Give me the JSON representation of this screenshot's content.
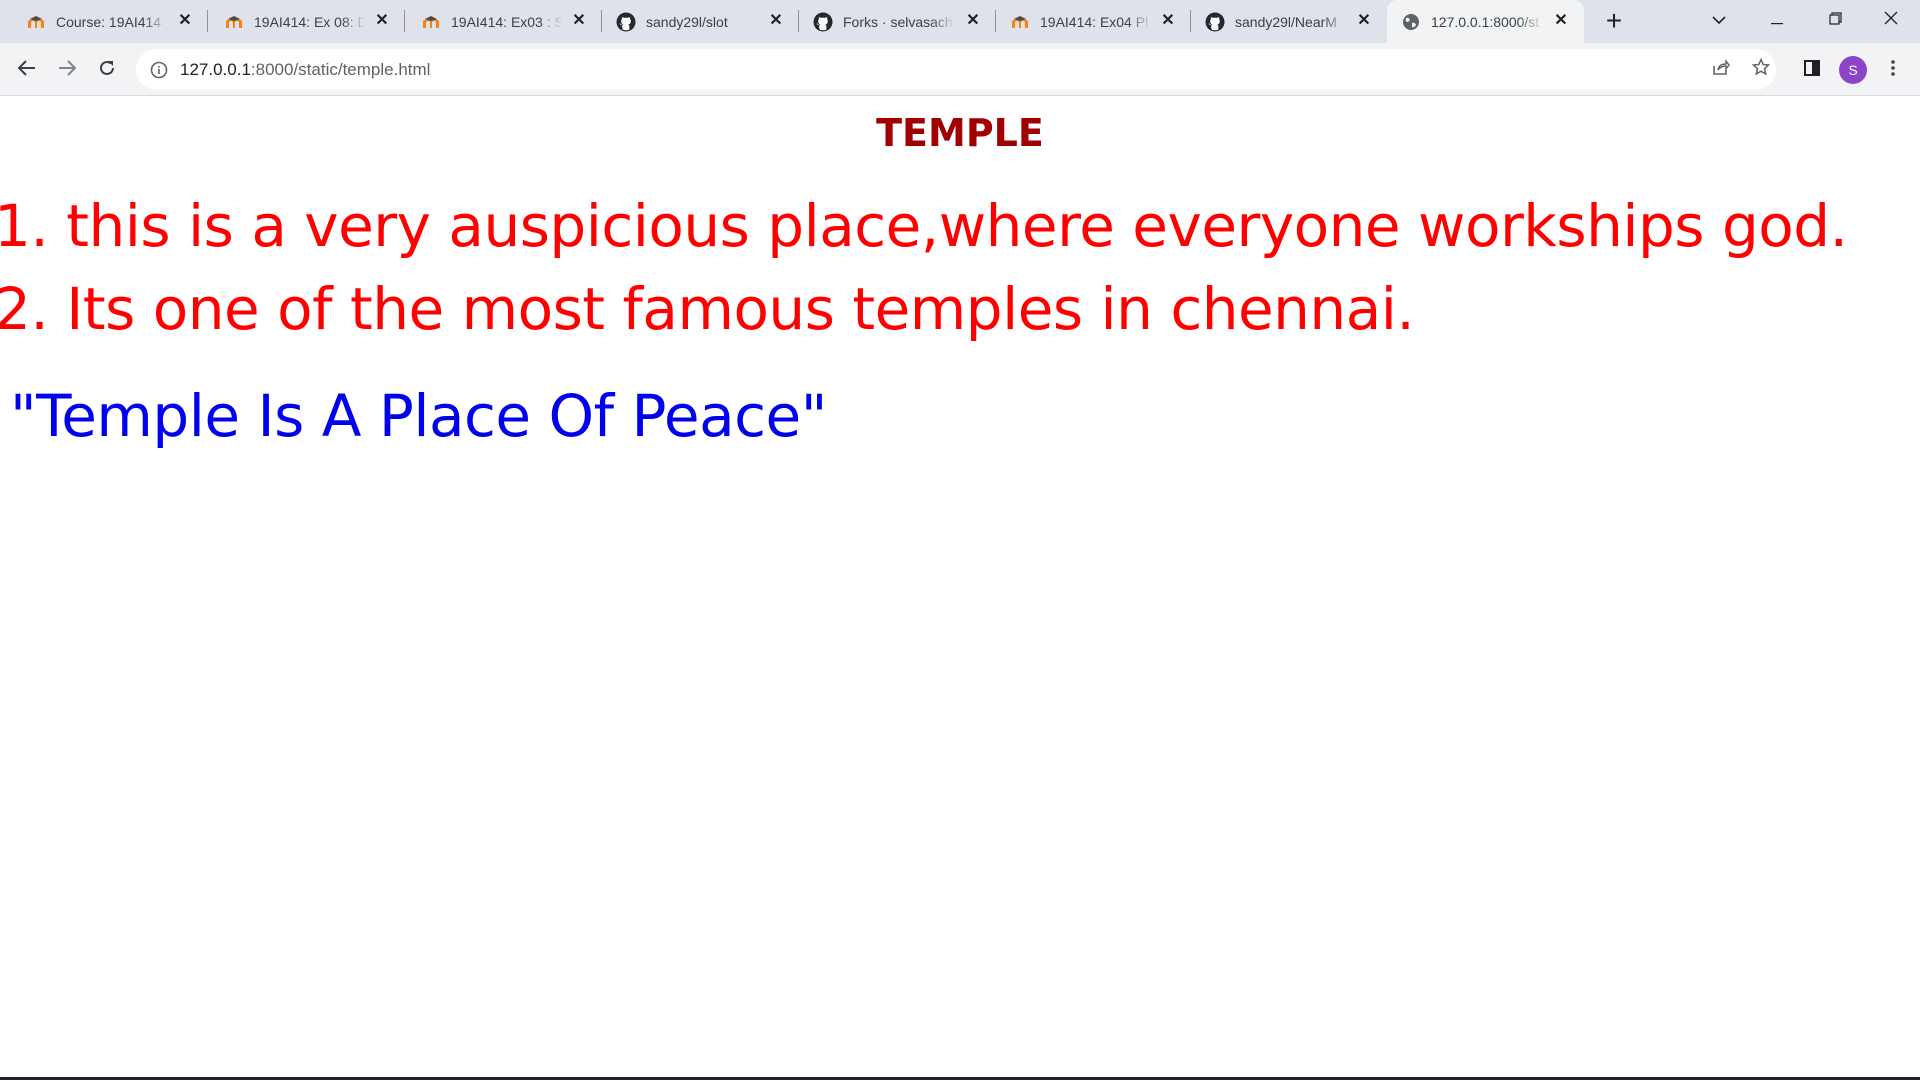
{
  "browser": {
    "tabs": [
      {
        "title": "Course: 19AI414",
        "favicon": "moodle-icon",
        "active": false
      },
      {
        "title": "19AI414: Ex 08: D",
        "favicon": "moodle-icon",
        "active": false
      },
      {
        "title": "19AI414: Ex03 : S",
        "favicon": "moodle-icon",
        "active": false
      },
      {
        "title": "sandy29l/slot",
        "favicon": "github-icon",
        "active": false
      },
      {
        "title": "Forks · selvasach",
        "favicon": "github-icon",
        "active": false
      },
      {
        "title": "19AI414: Ex04 Pl",
        "favicon": "moodle-icon",
        "active": false
      },
      {
        "title": "sandy29l/NearM",
        "favicon": "github-icon",
        "active": false
      },
      {
        "title": "127.0.0.1:8000/st",
        "favicon": "globe-icon",
        "active": true
      }
    ],
    "url_host": "127.0.0.1",
    "url_rest": ":8000/static/temple.html",
    "profile_initial": "S",
    "colors": {
      "tabstrip": "#dee3eb",
      "toolbar": "#f1f3f4",
      "avatar": "#8e44c7"
    }
  },
  "page": {
    "title": "TEMPLE",
    "points": [
      "1. this is a very auspicious place,where everyone workships god.",
      "2. Its one of the most famous temples in chennai."
    ],
    "quote": "\"Temple Is A Place Of Peace\"",
    "colors": {
      "title": "#a00000",
      "points": "#ff0000",
      "quote": "#0000ee"
    }
  }
}
